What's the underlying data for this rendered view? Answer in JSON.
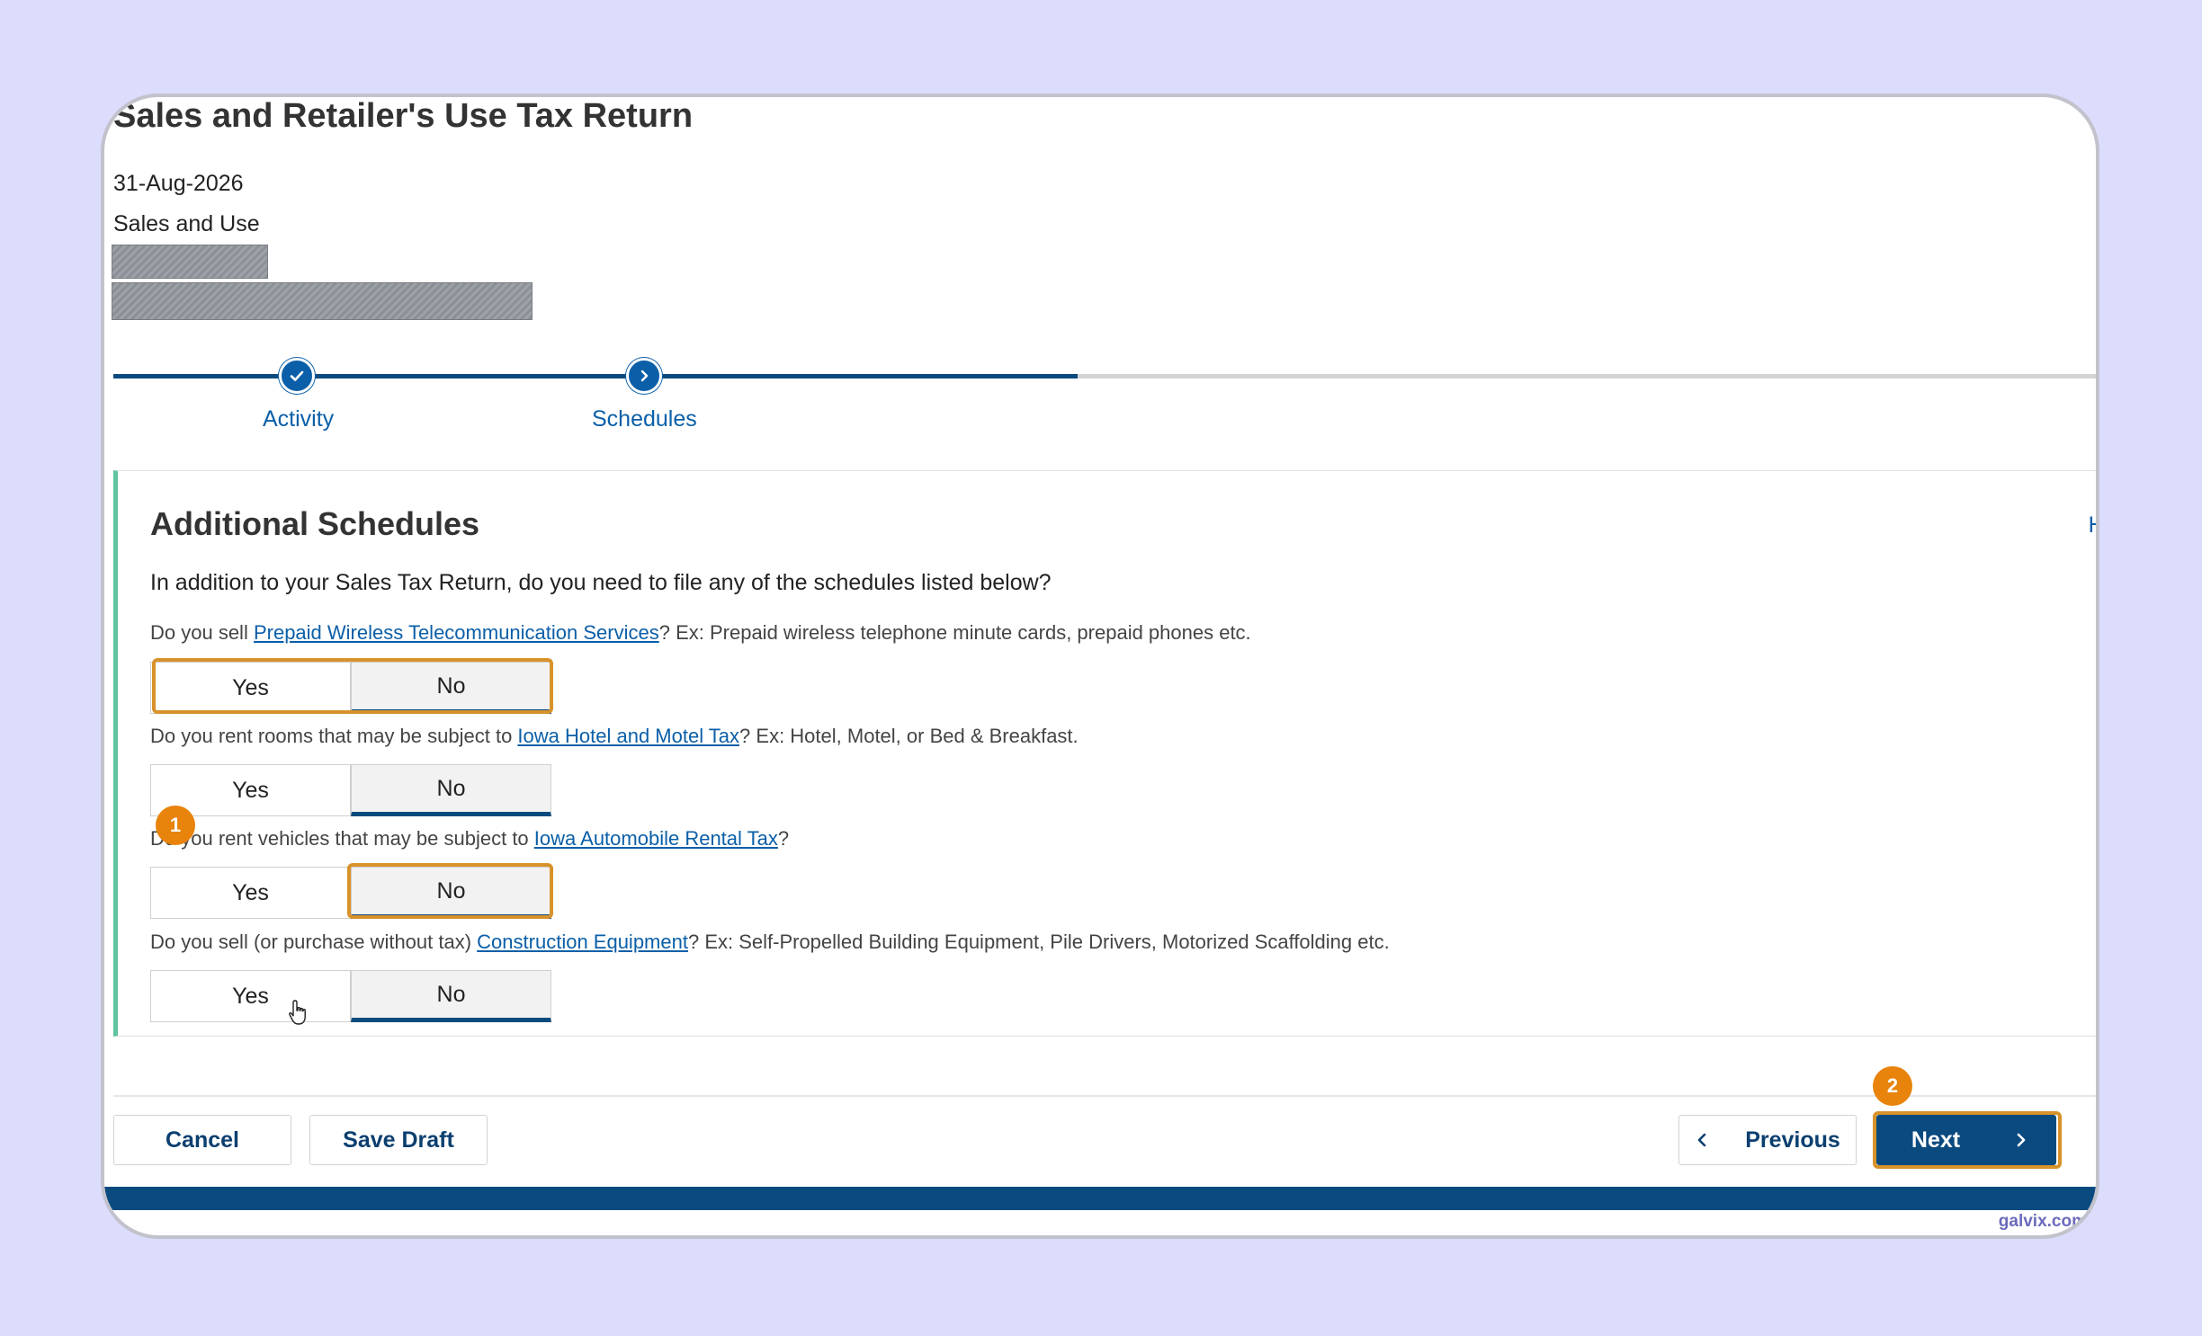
{
  "colors": {
    "background": "#dcdcfd",
    "primary": "#0b4a7f",
    "link": "#0b5fa8",
    "card_accent": "#5fc59e",
    "highlight": "#d8922a",
    "badge": "#e8830c"
  },
  "header": {
    "title": "Sales and Retailer's Use Tax Return",
    "period": "31-Aug-2026",
    "tax_type": "Sales and Use"
  },
  "stepper": {
    "steps": [
      {
        "label": "Activity",
        "status": "complete",
        "icon": "check-icon"
      },
      {
        "label": "Schedules",
        "status": "current",
        "icon": "chevron-right-icon"
      }
    ]
  },
  "schedules": {
    "title": "Additional Schedules",
    "help_label": "Help",
    "intro": "In addition to your Sales Tax Return, do you need to file any of the schedules listed below?",
    "questions": [
      {
        "prefix": "Do you sell ",
        "link": "Prepaid Wireless Telecommunication Services",
        "suffix": "? Ex: Prepaid wireless telephone minute cards, prepaid phones etc.",
        "yes": "Yes",
        "no": "No",
        "selected": "No"
      },
      {
        "prefix": "Do you rent rooms that may be subject to ",
        "link": "Iowa Hotel and Motel Tax",
        "suffix": "? Ex: Hotel, Motel, or Bed & Breakfast.",
        "yes": "Yes",
        "no": "No",
        "selected": "No"
      },
      {
        "prefix": "Do you rent vehicles that may be subject to ",
        "link": "Iowa Automobile Rental Tax",
        "suffix": "?",
        "yes": "Yes",
        "no": "No",
        "selected": "No"
      },
      {
        "prefix": "Do you sell (or purchase without tax) ",
        "link": "Construction Equipment",
        "suffix": "? Ex: Self-Propelled Building Equipment, Pile Drivers, Motorized Scaffolding etc.",
        "yes": "Yes",
        "no": "No",
        "selected": "No"
      }
    ]
  },
  "annotations": {
    "badge1": "1",
    "badge2": "2"
  },
  "footer": {
    "cancel": "Cancel",
    "save_draft": "Save Draft",
    "previous": "Previous",
    "next": "Next"
  },
  "watermark": "galvix.com"
}
